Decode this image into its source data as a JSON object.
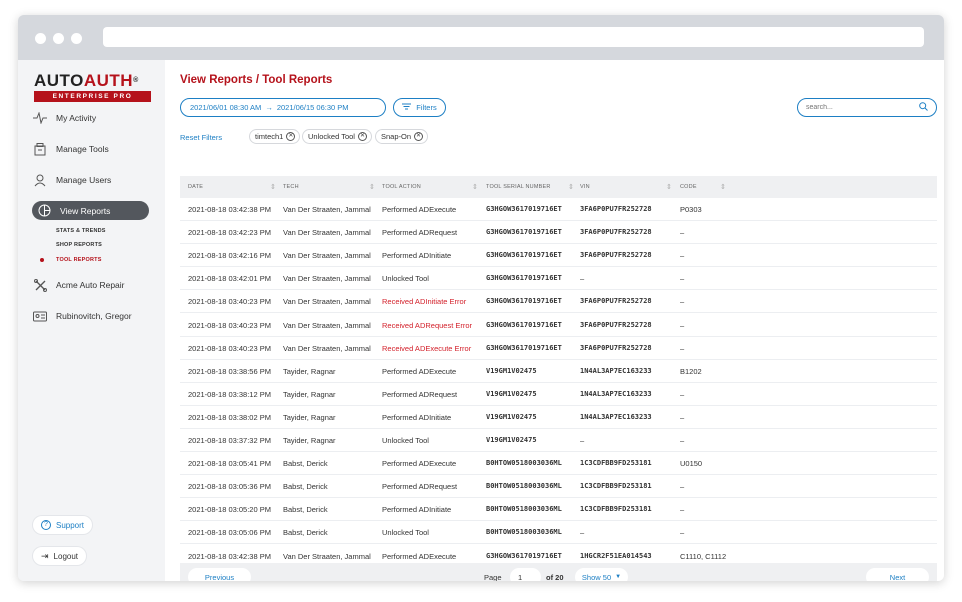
{
  "brand": {
    "name_part1": "AUTO",
    "name_part2": "AUTH",
    "registered": "®",
    "tagline": "ENTERPRISE PRO"
  },
  "sidebar": {
    "items": [
      {
        "label": "My Activity",
        "icon": "activity-icon"
      },
      {
        "label": "Manage Tools",
        "icon": "tools-icon"
      },
      {
        "label": "Manage Users",
        "icon": "users-icon"
      },
      {
        "label": "View Reports",
        "icon": "reports-icon",
        "active": true
      },
      {
        "label": "Acme Auto Repair",
        "icon": "wrench-icon"
      },
      {
        "label": "Rubinovitch, Gregor",
        "icon": "id-card-icon"
      }
    ],
    "subitems": [
      {
        "label": "STATS & TRENDS"
      },
      {
        "label": "SHOP REPORTS"
      },
      {
        "label": "TOOL REPORTS",
        "current": true
      }
    ],
    "support_label": "Support",
    "logout_label": "Logout"
  },
  "header": {
    "title": "View Reports / Tool Reports",
    "date_start": "2021/06/01 08:30 AM",
    "date_end": "2021/06/15 06:30 PM",
    "filters_label": "Filters",
    "search_placeholder": "search..."
  },
  "filters": {
    "reset_label": "Reset Filters",
    "chips": [
      "timtech1",
      "Unlocked Tool",
      "Snap-On"
    ]
  },
  "table": {
    "columns": [
      "DATE",
      "TECH",
      "TOOL ACTION",
      "TOOL SERIAL NUMBER",
      "VIN",
      "CODE"
    ],
    "rows": [
      [
        "2021-08-18 03:42:38 PM",
        "Van Der Straaten, Jammal",
        "Performed ADExecute",
        "G3HGOW3617019716ET",
        "3FA6P0PU7FR252728",
        "P0303"
      ],
      [
        "2021-08-18 03:42:23 PM",
        "Van Der Straaten, Jammal",
        "Performed ADRequest",
        "G3HGOW3617019716ET",
        "3FA6P0PU7FR252728",
        "–"
      ],
      [
        "2021-08-18 03:42:16 PM",
        "Van Der Straaten, Jammal",
        "Performed ADInitiate",
        "G3HGOW3617019716ET",
        "3FA6P0PU7FR252728",
        "–"
      ],
      [
        "2021-08-18 03:42:01 PM",
        "Van Der Straaten, Jammal",
        "Unlocked Tool",
        "G3HGOW3617019716ET",
        "–",
        "–"
      ],
      [
        "2021-08-18 03:40:23 PM",
        "Van Der Straaten, Jammal",
        "Received ADInitiate Error",
        "G3HGOW3617019716ET",
        "3FA6P0PU7FR252728",
        "–"
      ],
      [
        "2021-08-18 03:40:23 PM",
        "Van Der Straaten, Jammal",
        "Received ADRequest Error",
        "G3HGOW3617019716ET",
        "3FA6P0PU7FR252728",
        "–"
      ],
      [
        "2021-08-18 03:40:23 PM",
        "Van Der Straaten, Jammal",
        "Received ADExecute Error",
        "G3HGOW3617019716ET",
        "3FA6P0PU7FR252728",
        "–"
      ],
      [
        "2021-08-18 03:38:56 PM",
        "Tayider, Ragnar",
        "Performed ADExecute",
        "V19GM1V02475",
        "1N4AL3AP7EC163233",
        "B1202"
      ],
      [
        "2021-08-18 03:38:12 PM",
        "Tayider, Ragnar",
        "Performed ADRequest",
        "V19GM1V02475",
        "1N4AL3AP7EC163233",
        "–"
      ],
      [
        "2021-08-18 03:38:02 PM",
        "Tayider, Ragnar",
        "Performed ADInitiate",
        "V19GM1V02475",
        "1N4AL3AP7EC163233",
        "–"
      ],
      [
        "2021-08-18 03:37:32 PM",
        "Tayider, Ragnar",
        "Unlocked Tool",
        "V19GM1V02475",
        "–",
        "–"
      ],
      [
        "2021-08-18 03:05:41 PM",
        "Babst, Derick",
        "Performed ADExecute",
        "B0HTOW0518003036ML",
        "1C3CDFBB9FD253181",
        "U0150"
      ],
      [
        "2021-08-18 03:05:36 PM",
        "Babst, Derick",
        "Performed ADRequest",
        "B0HTOW0518003036ML",
        "1C3CDFBB9FD253181",
        "–"
      ],
      [
        "2021-08-18 03:05:20 PM",
        "Babst, Derick",
        "Performed ADInitiate",
        "B0HTOW0518003036ML",
        "1C3CDFBB9FD253181",
        "–"
      ],
      [
        "2021-08-18 03:05:06 PM",
        "Babst, Derick",
        "Unlocked Tool",
        "B0HTOW0518003036ML",
        "–",
        "–"
      ],
      [
        "2021-08-18 03:42:38 PM",
        "Van Der Straaten, Jammal",
        "Performed ADExecute",
        "G3HGOW3617019716ET",
        "1HGCR2F51EA014543",
        "C1110, C1112"
      ]
    ]
  },
  "pagination": {
    "previous_label": "Previous",
    "page_label": "Page",
    "page_value": "1",
    "of_label": "of 20",
    "show_label": "Show 50",
    "next_label": "Next"
  },
  "colors": {
    "brand_red": "#b5121b",
    "link_blue": "#1d7fc4",
    "error_red": "#d3212b",
    "active_nav": "#53575d"
  }
}
